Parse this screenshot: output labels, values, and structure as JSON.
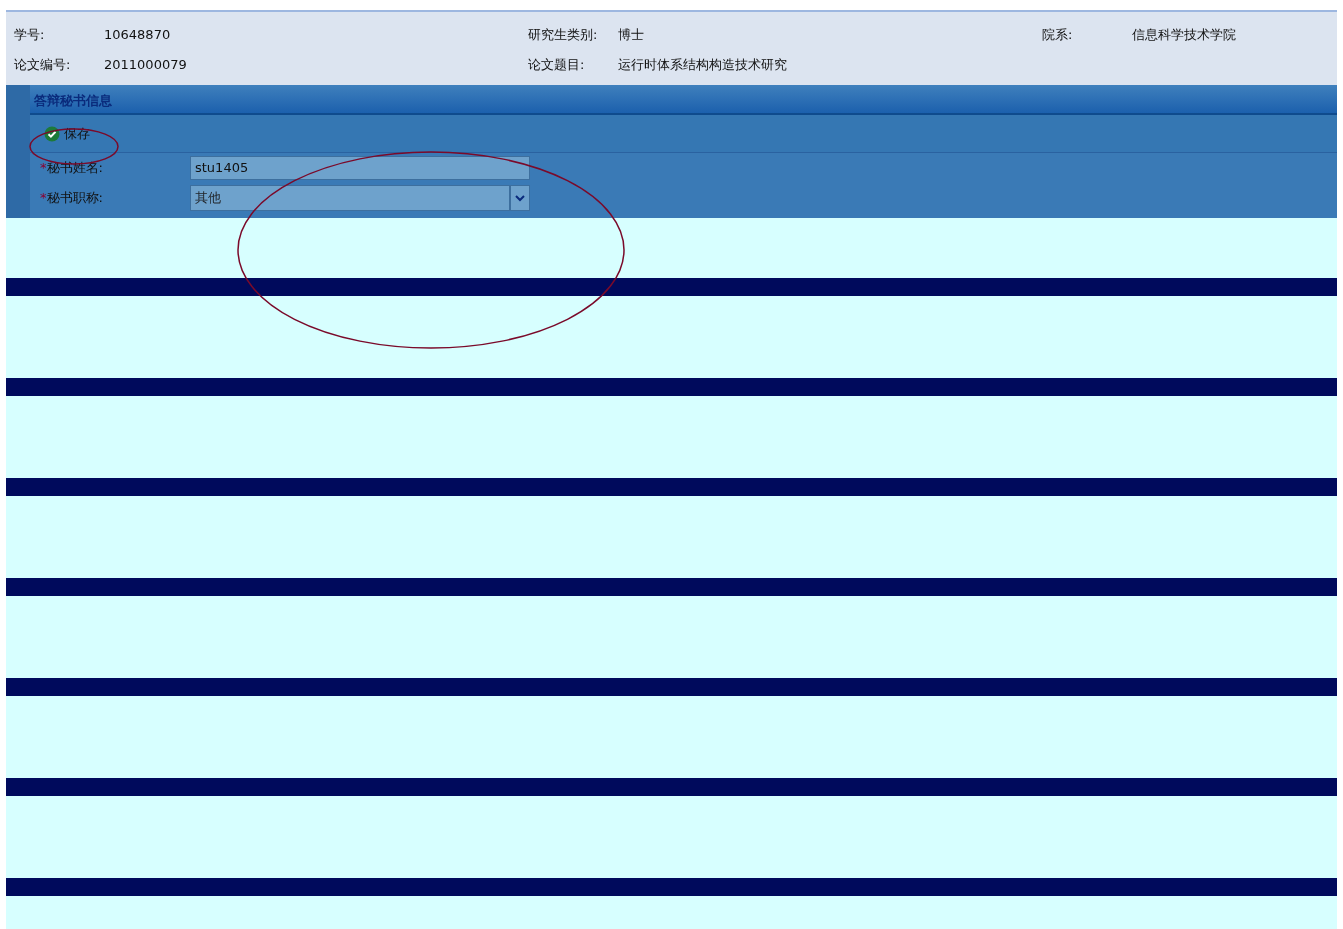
{
  "student_info": [
    {
      "label": "学号:",
      "value": "10648870"
    },
    {
      "label": "研究生类别:",
      "value": "博士"
    },
    {
      "label": "院系:",
      "value": "信息科学技术学院"
    },
    {
      "label": "论文编号:",
      "value": "2011000079"
    },
    {
      "label": "论文题目:",
      "value": "运行时体系结构构造技术研究"
    }
  ],
  "panel": {
    "title": "答辩秘书信息",
    "save_button": "保存",
    "fields": [
      {
        "kind": "text",
        "label": "秘书姓名:",
        "required_mark": "*",
        "value": "stu1405"
      },
      {
        "kind": "select",
        "label": "秘书职称:",
        "required_mark": "*",
        "value": "其他"
      }
    ]
  }
}
